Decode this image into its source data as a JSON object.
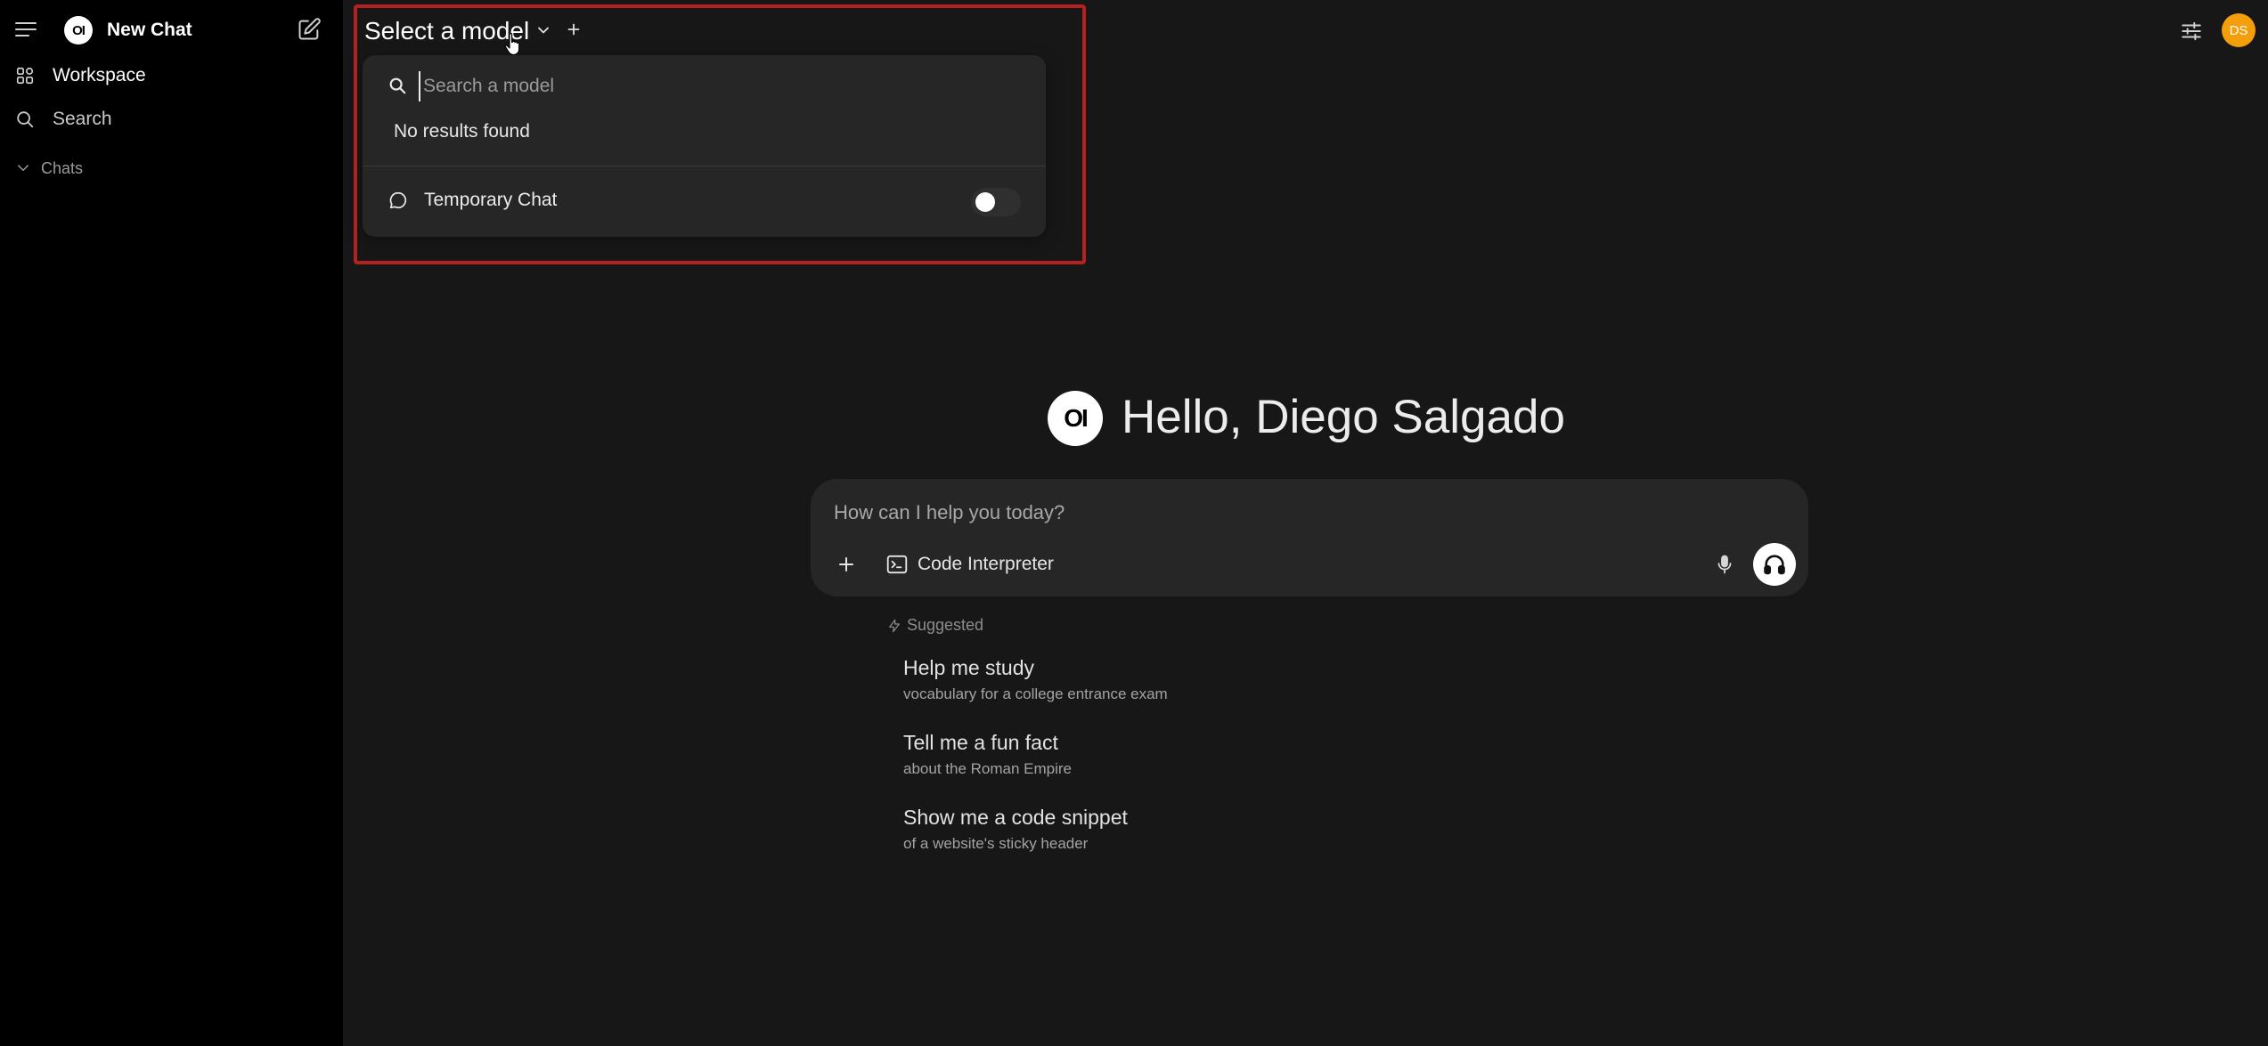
{
  "sidebar": {
    "app_name": "New Chat",
    "logo_text": "OI",
    "items": [
      {
        "label": "Workspace",
        "icon": "grid-icon"
      },
      {
        "label": "Search",
        "icon": "search-icon"
      }
    ],
    "chats_section": "Chats"
  },
  "header": {
    "model_selector_label": "Select a model",
    "avatar_initials": "DS",
    "avatar_color": "#f59e0b",
    "highlight_color": "#b42121"
  },
  "model_dropdown": {
    "search_placeholder": "Search a model",
    "search_value": "",
    "empty_message": "No results found",
    "temporary_chat_label": "Temporary Chat",
    "temporary_chat_enabled": false
  },
  "main": {
    "logo_text": "OI",
    "greeting": "Hello, Diego Salgado",
    "composer": {
      "placeholder": "How can I help you today?",
      "value": "",
      "code_interpreter_label": "Code Interpreter"
    },
    "suggested_header": "Suggested",
    "suggestions": [
      {
        "title": "Help me study",
        "subtitle": "vocabulary for a college entrance exam"
      },
      {
        "title": "Tell me a fun fact",
        "subtitle": "about the Roman Empire"
      },
      {
        "title": "Show me a code snippet",
        "subtitle": "of a website's sticky header"
      }
    ]
  }
}
